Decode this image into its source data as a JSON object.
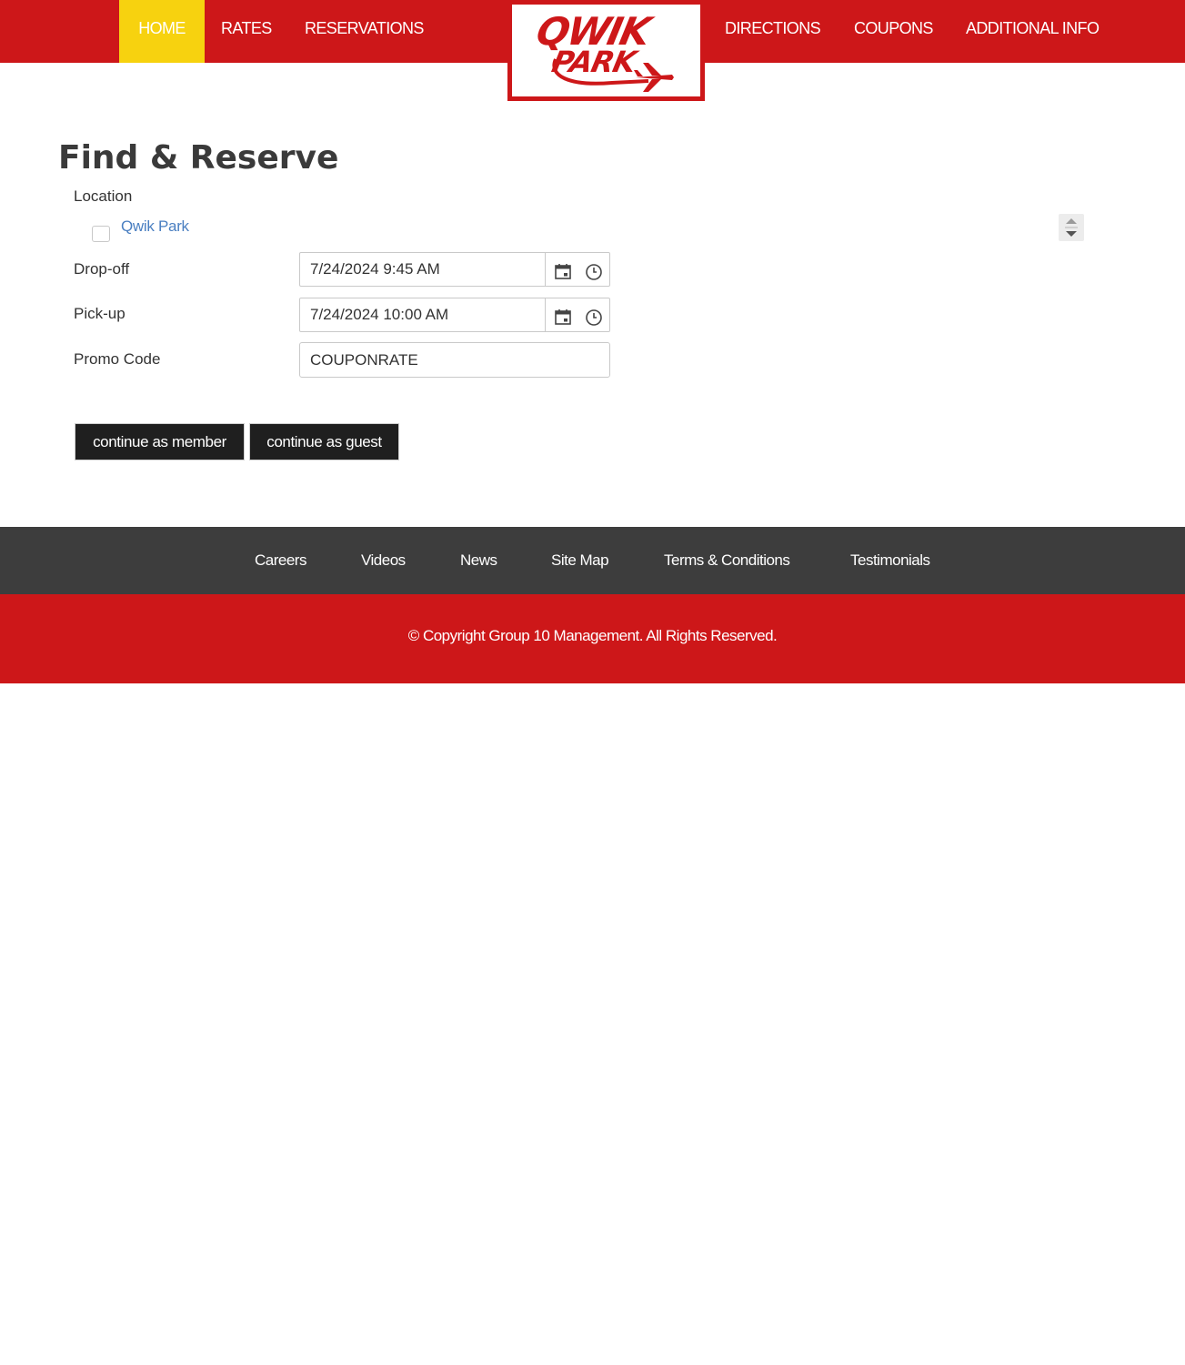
{
  "nav": {
    "items": [
      {
        "label": "HOME",
        "active": true
      },
      {
        "label": "RATES"
      },
      {
        "label": "RESERVATIONS"
      },
      {
        "label": "DIRECTIONS"
      },
      {
        "label": "COUPONS"
      },
      {
        "label": "ADDITIONAL INFO"
      }
    ]
  },
  "logo": {
    "line1": "QWIK",
    "line2": "PARK",
    "icon": "airplane-icon"
  },
  "form": {
    "title": "Find & Reserve",
    "location_label": "Location",
    "location_option": "Qwik Park",
    "location_checked": false,
    "dropoff_label": "Drop-off",
    "dropoff_value": "7/24/2024 9:45 AM",
    "pickup_label": "Pick-up",
    "pickup_value": "7/24/2024 10:00 AM",
    "promo_label": "Promo Code",
    "promo_value": "COUPONRATE",
    "member_button": "continue as member",
    "guest_button": "continue as guest"
  },
  "icons": {
    "calendar": "calendar-icon",
    "clock": "clock-icon",
    "spinner": "sort-arrows-icon"
  },
  "footer": {
    "links": [
      "Careers",
      "Videos",
      "News",
      "Site Map",
      "Terms & Conditions",
      "Testimonials"
    ],
    "copyright": "© Copyright Group 10 Management. All Rights Reserved."
  },
  "colors": {
    "brand_red": "#cd1719",
    "nav_active": "#f7d20f",
    "footer_dark": "#3d3d3d",
    "button_dark": "#1f1f1f",
    "link_blue": "#4a7fc1"
  }
}
